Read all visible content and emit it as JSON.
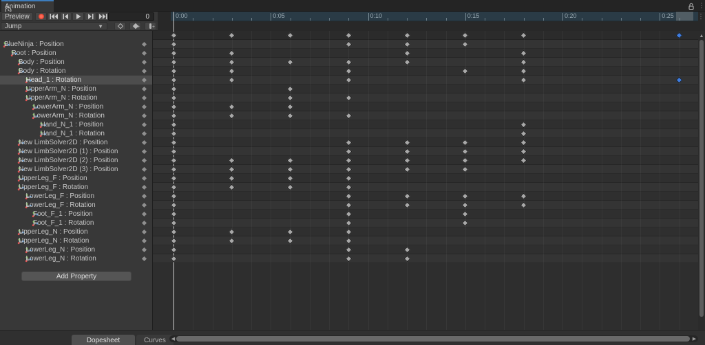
{
  "window": {
    "title": "Animation"
  },
  "toolbar": {
    "preview_label": "Preview",
    "record_icon": "record-circle-icon",
    "transport": [
      "go-to-first-frame",
      "previous-keyframe",
      "play",
      "next-keyframe",
      "go-to-last-frame"
    ],
    "frame_value": "0",
    "clip_selector": "Jump",
    "keyframe_buttons": [
      "keyframe-indicator",
      "add-keyframe",
      "add-event"
    ]
  },
  "ruler": {
    "labels": [
      "0:00",
      "0:05",
      "0:10",
      "0:15",
      "0:20",
      "0:25"
    ],
    "label_every_n_frames": 5,
    "visible_frames": 27
  },
  "properties": [
    {
      "label": "BlueNinja : Position",
      "level": 0,
      "selected": false,
      "keyframes": [
        0,
        9,
        12,
        15
      ],
      "selected_keyframes": []
    },
    {
      "label": "Root : Position",
      "level": 1,
      "selected": false,
      "keyframes": [
        0,
        3,
        12,
        18
      ],
      "selected_keyframes": []
    },
    {
      "label": "Body : Position",
      "level": 2,
      "selected": false,
      "keyframes": [
        0,
        3,
        6,
        9,
        12,
        18
      ],
      "selected_keyframes": []
    },
    {
      "label": "Body : Rotation",
      "level": 2,
      "selected": false,
      "keyframes": [
        0,
        3,
        9,
        15,
        18
      ],
      "selected_keyframes": []
    },
    {
      "label": "Head_1 : Rotation",
      "level": 3,
      "selected": true,
      "keyframes": [
        0,
        3,
        9,
        18
      ],
      "selected_keyframes": [
        26
      ]
    },
    {
      "label": "UpperArm_N : Position",
      "level": 3,
      "selected": false,
      "keyframes": [
        0,
        6
      ],
      "selected_keyframes": []
    },
    {
      "label": "UpperArm_N : Rotation",
      "level": 3,
      "selected": false,
      "keyframes": [
        0,
        6,
        9
      ],
      "selected_keyframes": []
    },
    {
      "label": "LowerArm_N : Position",
      "level": 4,
      "selected": false,
      "keyframes": [
        0,
        3,
        6
      ],
      "selected_keyframes": []
    },
    {
      "label": "LowerArm_N : Rotation",
      "level": 4,
      "selected": false,
      "keyframes": [
        0,
        3,
        6,
        9
      ],
      "selected_keyframes": []
    },
    {
      "label": "Hand_N_1 : Position",
      "level": 5,
      "selected": false,
      "keyframes": [
        0,
        18
      ],
      "selected_keyframes": []
    },
    {
      "label": "Hand_N_1 : Rotation",
      "level": 5,
      "selected": false,
      "keyframes": [
        0,
        18
      ],
      "selected_keyframes": []
    },
    {
      "label": "New LimbSolver2D : Position",
      "level": 2,
      "selected": false,
      "keyframes": [
        0,
        9,
        12,
        15,
        18
      ],
      "selected_keyframes": []
    },
    {
      "label": "New LimbSolver2D (1) : Position",
      "level": 2,
      "selected": false,
      "keyframes": [
        0,
        9,
        12,
        15,
        18
      ],
      "selected_keyframes": []
    },
    {
      "label": "New LimbSolver2D (2) : Position",
      "level": 2,
      "selected": false,
      "keyframes": [
        0,
        3,
        6,
        9,
        12,
        15,
        18
      ],
      "selected_keyframes": []
    },
    {
      "label": "New LimbSolver2D (3) : Position",
      "level": 2,
      "selected": false,
      "keyframes": [
        0,
        3,
        6,
        9,
        12,
        15
      ],
      "selected_keyframes": []
    },
    {
      "label": "UpperLeg_F : Position",
      "level": 2,
      "selected": false,
      "keyframes": [
        0,
        3,
        6,
        9
      ],
      "selected_keyframes": []
    },
    {
      "label": "UpperLeg_F : Rotation",
      "level": 2,
      "selected": false,
      "keyframes": [
        0,
        3,
        6,
        9
      ],
      "selected_keyframes": []
    },
    {
      "label": "LowerLeg_F : Position",
      "level": 3,
      "selected": false,
      "keyframes": [
        0,
        9,
        12,
        15,
        18
      ],
      "selected_keyframes": []
    },
    {
      "label": "LowerLeg_F : Rotation",
      "level": 3,
      "selected": false,
      "keyframes": [
        0,
        9,
        12,
        15,
        18
      ],
      "selected_keyframes": []
    },
    {
      "label": "Foot_F_1 : Position",
      "level": 4,
      "selected": false,
      "keyframes": [
        0,
        9,
        15
      ],
      "selected_keyframes": []
    },
    {
      "label": "Foot_F_1 : Rotation",
      "level": 4,
      "selected": false,
      "keyframes": [
        0,
        9,
        15
      ],
      "selected_keyframes": []
    },
    {
      "label": "UpperLeg_N : Position",
      "level": 2,
      "selected": false,
      "keyframes": [
        0,
        3,
        6,
        9
      ],
      "selected_keyframes": []
    },
    {
      "label": "UpperLeg_N : Rotation",
      "level": 2,
      "selected": false,
      "keyframes": [
        0,
        3,
        6,
        9
      ],
      "selected_keyframes": []
    },
    {
      "label": "LowerLeg_N : Position",
      "level": 3,
      "selected": false,
      "keyframes": [
        0,
        9,
        12
      ],
      "selected_keyframes": []
    },
    {
      "label": "LowerLeg_N : Rotation",
      "level": 3,
      "selected": false,
      "keyframes": [
        0,
        9,
        12
      ],
      "selected_keyframes": []
    }
  ],
  "summary_row": {
    "keyframes": [
      0,
      3,
      6,
      9,
      12,
      15,
      18
    ],
    "selected_keyframes": [
      26
    ]
  },
  "add_property_label": "Add Property",
  "footer_tabs": [
    {
      "label": "Dopesheet",
      "selected": true
    },
    {
      "label": "Curves",
      "selected": false
    }
  ],
  "playhead_frame": 0,
  "colors": {
    "key_fill": "#a8a8a8",
    "key_selected": "#3e7de2",
    "ruler_bg": "#2a3b46",
    "record_red": "#de3c2c",
    "active_tab_accent": "#3d7dbd",
    "panel_bg": "#383838",
    "stripe_light": "#343434",
    "stripe_dark": "#2f2f2f"
  }
}
